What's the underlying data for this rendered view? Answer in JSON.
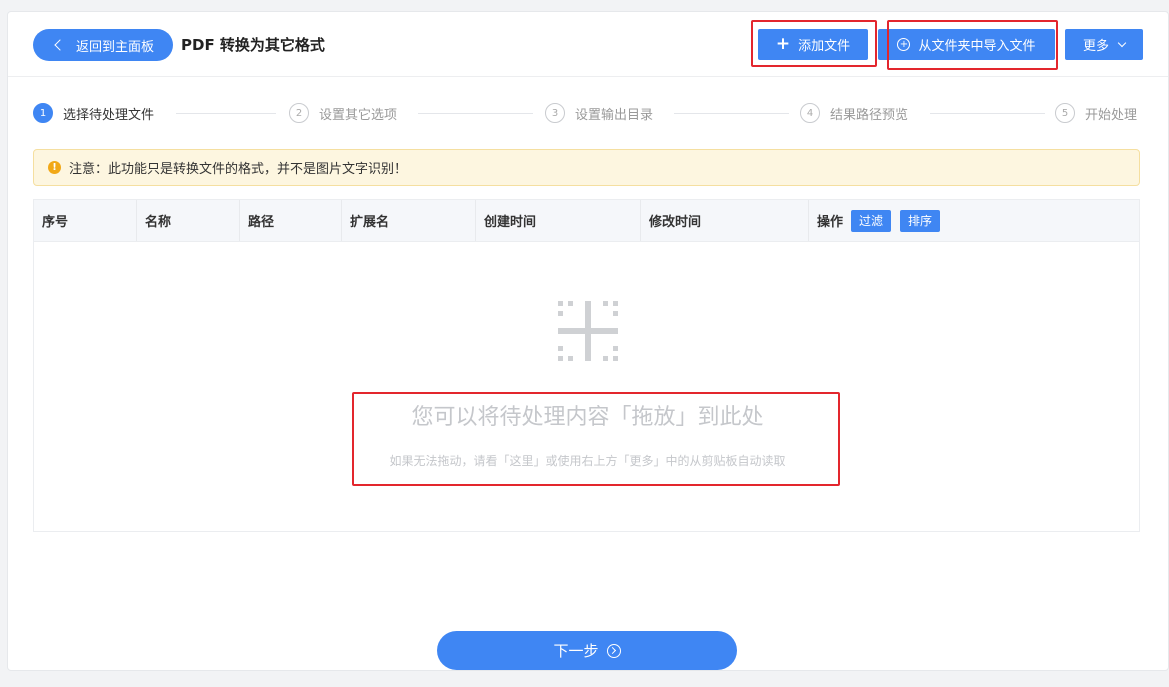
{
  "header": {
    "back_label": "返回到主面板",
    "title": "PDF 转换为其它格式",
    "add_label": "添加文件",
    "import_label": "从文件夹中导入文件",
    "more_label": "更多"
  },
  "steps": [
    {
      "num": "1",
      "label": "选择待处理文件"
    },
    {
      "num": "2",
      "label": "设置其它选项"
    },
    {
      "num": "3",
      "label": "设置输出目录"
    },
    {
      "num": "4",
      "label": "结果路径预览"
    },
    {
      "num": "5",
      "label": "开始处理"
    }
  ],
  "notice": {
    "text": "注意：此功能只是转换文件的格式，并不是图片文字识别！"
  },
  "table": {
    "columns": [
      "序号",
      "名称",
      "路径",
      "扩展名",
      "创建时间",
      "修改时间",
      "操作"
    ],
    "filter_label": "过滤",
    "sort_label": "排序"
  },
  "drop": {
    "title": "您可以将待处理内容「拖放」到此处",
    "subtitle": "如果无法拖动，请看「这里」或使用右上方「更多」中的从剪贴板自动读取"
  },
  "footer": {
    "next_label": "下一步"
  },
  "colors": {
    "accent": "#3f86f3",
    "highlight": "#e3262d",
    "notice_bg": "#fdf6e0"
  }
}
